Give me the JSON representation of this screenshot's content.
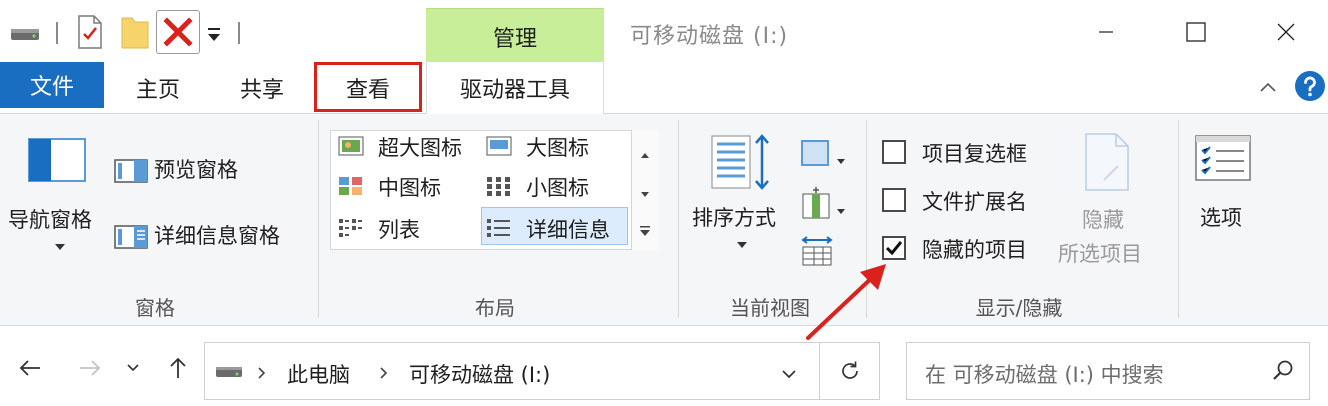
{
  "titlebar": {
    "window_title": "可移动磁盘 (I:)",
    "contextual_tab": "管理"
  },
  "tabs": {
    "file": "文件",
    "home": "主页",
    "share": "共享",
    "view": "查看",
    "drive_tools": "驱动器工具"
  },
  "ribbon": {
    "panes": {
      "nav_pane": "导航窗格",
      "preview_pane": "预览窗格",
      "details_pane": "详细信息窗格",
      "label": "窗格"
    },
    "layout": {
      "extra_large": "超大图标",
      "large": "大图标",
      "medium": "中图标",
      "small": "小图标",
      "list": "列表",
      "details": "详细信息",
      "label": "布局"
    },
    "current_view": {
      "sort_by": "排序方式",
      "label": "当前视图"
    },
    "show_hide": {
      "item_checkboxes": "项目复选框",
      "file_extensions": "文件扩展名",
      "hidden_items": "隐藏的项目",
      "hide_selected_line1": "隐藏",
      "hide_selected_line2": "所选项目",
      "label": "显示/隐藏",
      "item_checkboxes_checked": false,
      "file_extensions_checked": false,
      "hidden_items_checked": true
    },
    "options": {
      "label": "选项"
    }
  },
  "address": {
    "crumbs": [
      "此电脑",
      "可移动磁盘 (I:)"
    ],
    "search_placeholder": "在 可移动磁盘 (I:) 中搜索"
  },
  "colors": {
    "file_tab": "#1a6ec1",
    "contextual_tab": "#c8ee9a",
    "highlight_box": "#d9221c",
    "annotation_arrow": "#d9221c",
    "help_icon": "#1a6ec1"
  }
}
